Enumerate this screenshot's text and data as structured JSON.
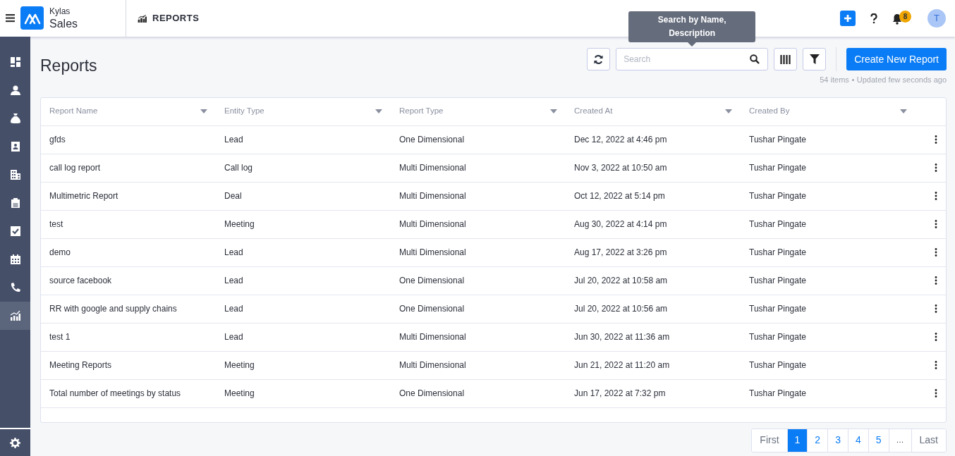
{
  "header": {
    "brand_top": "Kylas",
    "brand_bottom": "Sales",
    "section": "REPORTS",
    "notification_count": "8",
    "avatar_initial": "T"
  },
  "sidebar": {
    "items": [
      {
        "kind": "dashboard",
        "selected": false
      },
      {
        "kind": "user",
        "selected": false
      },
      {
        "kind": "moneybag",
        "selected": false
      },
      {
        "kind": "contact",
        "selected": false
      },
      {
        "kind": "building",
        "selected": false
      },
      {
        "kind": "clipboard",
        "selected": false
      },
      {
        "kind": "checkbox",
        "selected": false
      },
      {
        "kind": "calendar",
        "selected": false
      },
      {
        "kind": "phone",
        "selected": false
      },
      {
        "kind": "chart",
        "selected": true
      }
    ]
  },
  "page_title": "Reports",
  "toolbar": {
    "search": {
      "placeholder": "Search",
      "tooltip": "Search by Name, Description"
    },
    "create_button": "Create New Report",
    "item_count": "54 items",
    "updated": "Updated few seconds ago"
  },
  "table": {
    "columns": [
      "Report Name",
      "Entity Type",
      "Report Type",
      "Created At",
      "Created By"
    ],
    "rows": [
      [
        "gfds",
        "Lead",
        "One Dimensional",
        "Dec 12, 2022 at 4:46 pm",
        "Tushar Pingate"
      ],
      [
        "call log report",
        "Call log",
        "Multi Dimensional",
        "Nov 3, 2022 at 10:50 am",
        "Tushar Pingate"
      ],
      [
        "Multimetric Report",
        "Deal",
        "Multi Dimensional",
        "Oct 12, 2022 at 5:14 pm",
        "Tushar Pingate"
      ],
      [
        "test",
        "Meeting",
        "Multi Dimensional",
        "Aug 30, 2022 at 4:14 pm",
        "Tushar Pingate"
      ],
      [
        "demo",
        "Lead",
        "Multi Dimensional",
        "Aug 17, 2022 at 3:26 pm",
        "Tushar Pingate"
      ],
      [
        "source facebook",
        "Lead",
        "One Dimensional",
        "Jul 20, 2022 at 10:58 am",
        "Tushar Pingate"
      ],
      [
        "RR with google and supply chains",
        "Lead",
        "One Dimensional",
        "Jul 20, 2022 at 10:56 am",
        "Tushar Pingate"
      ],
      [
        "test 1",
        "Lead",
        "Multi Dimensional",
        "Jun 30, 2022 at 11:36 am",
        "Tushar Pingate"
      ],
      [
        "Meeting Reports",
        "Meeting",
        "Multi Dimensional",
        "Jun 21, 2022 at 11:20 am",
        "Tushar Pingate"
      ],
      [
        "Total number of meetings by status",
        "Meeting",
        "One Dimensional",
        "Jun 17, 2022 at 7:32 pm",
        "Tushar Pingate"
      ]
    ]
  },
  "pagination": [
    {
      "label": "First",
      "kind": "nav",
      "selected": false
    },
    {
      "label": "1",
      "kind": "page",
      "selected": true
    },
    {
      "label": "2",
      "kind": "page",
      "selected": false
    },
    {
      "label": "3",
      "kind": "page",
      "selected": false
    },
    {
      "label": "4",
      "kind": "page",
      "selected": false
    },
    {
      "label": "5",
      "kind": "page",
      "selected": false
    },
    {
      "label": "…",
      "kind": "ellipsis",
      "selected": false
    },
    {
      "label": "Last",
      "kind": "nav",
      "selected": false
    }
  ]
}
